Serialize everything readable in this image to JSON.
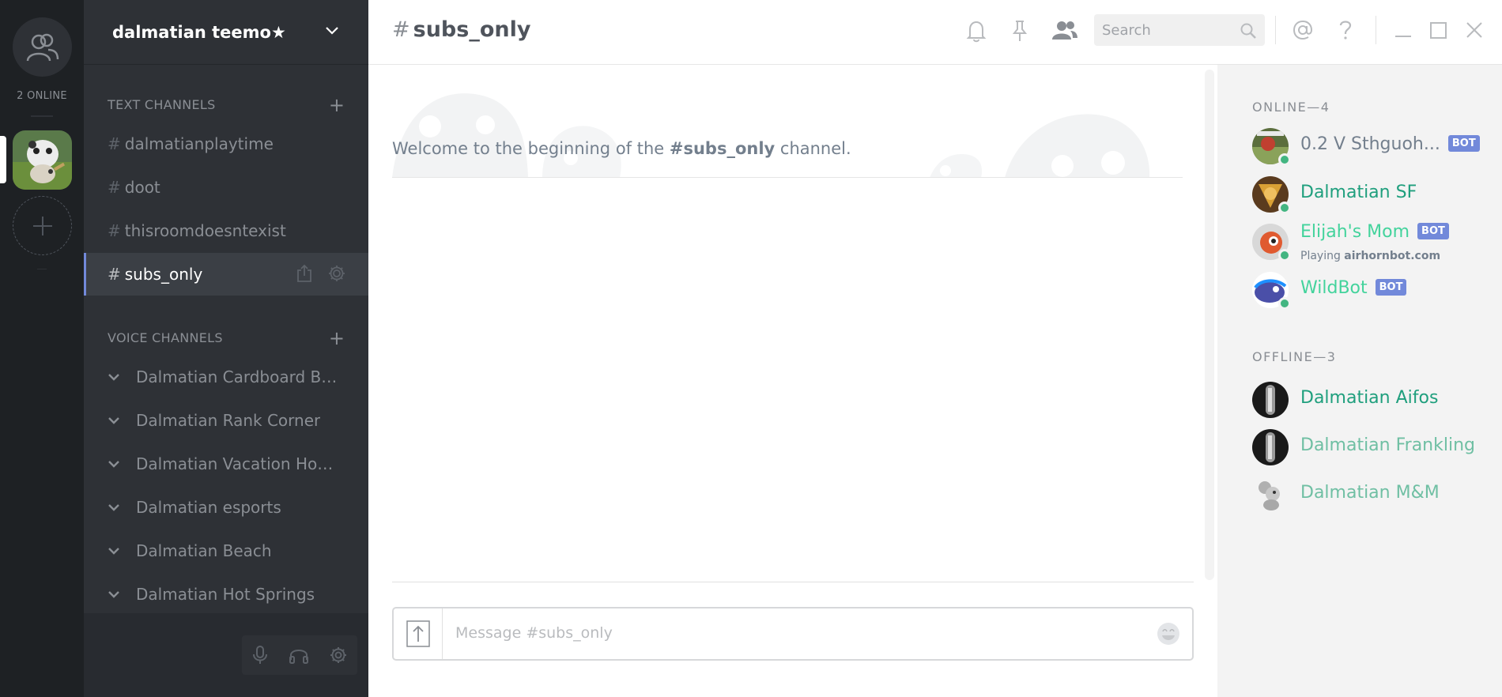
{
  "rail": {
    "online_count": "2 ONLINE"
  },
  "guild": {
    "name": "dalmatian teemo★"
  },
  "text_category": {
    "label": "TEXT CHANNELS"
  },
  "text_channels": [
    {
      "hash": "#",
      "name": "dalmatianplaytime"
    },
    {
      "hash": "#",
      "name": "doot"
    },
    {
      "hash": "#",
      "name": "thisroomdoesntexist"
    },
    {
      "hash": "#",
      "name": "subs_only"
    }
  ],
  "voice_category": {
    "label": "VOICE CHANNELS"
  },
  "voice_channels": [
    {
      "name": "Dalmatian Cardboard Bo..."
    },
    {
      "name": "Dalmatian Rank Corner"
    },
    {
      "name": "Dalmatian Vacation House"
    },
    {
      "name": "Dalmatian esports"
    },
    {
      "name": "Dalmatian Beach"
    },
    {
      "name": "Dalmatian Hot Springs"
    }
  ],
  "header": {
    "hash": "#",
    "channel": "subs_only",
    "search_placeholder": "Search"
  },
  "welcome": {
    "prefix": "Welcome to the beginning of the ",
    "channel": "#subs_only",
    "suffix": " channel."
  },
  "composer": {
    "placeholder": "Message #subs_only"
  },
  "members": {
    "online_label": "ONLINE—4",
    "offline_label": "OFFLINE—3",
    "bot_tag": "BOT",
    "online": [
      {
        "name": "0.2 V Sthguoh...",
        "color": "#737f8d",
        "bot": true
      },
      {
        "name": "Dalmatian SF",
        "color": "#1f9f7d",
        "bot": false
      },
      {
        "name": "Elijah's Mom",
        "color": "#43d39c",
        "bot": true,
        "playing_prefix": "Playing ",
        "playing_game": "airhornbot.com"
      },
      {
        "name": "WildBot",
        "color": "#43d39c",
        "bot": true
      }
    ],
    "offline": [
      {
        "name": "Dalmatian Aifos",
        "color": "#1f9f7d"
      },
      {
        "name": "Dalmatian Frankling",
        "color": "#6fbfa3"
      },
      {
        "name": "Dalmatian M&M",
        "color": "#6fbfa3"
      }
    ]
  },
  "colors": {
    "accent": "#7289da",
    "online_status": "#43b581",
    "rail_bg": "#1e2124",
    "sidebar_bg": "#2e3136"
  }
}
